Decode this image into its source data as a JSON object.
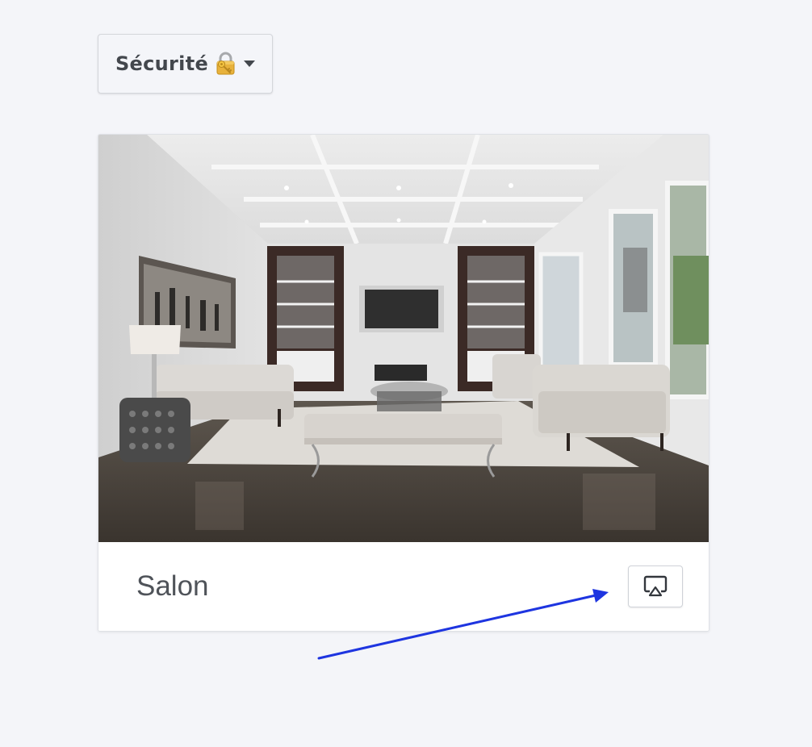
{
  "dropdown": {
    "label": "Sécurité",
    "icon": "locked-with-key-icon",
    "caret_icon": "caret-down-icon"
  },
  "card": {
    "image": "living-room-photo",
    "title": "Salon",
    "action_icon": "airplay-icon"
  },
  "annotation": {
    "type": "arrow",
    "color": "#1e35e0",
    "points_to": "airplay-button"
  },
  "colors": {
    "background": "#f4f5f9",
    "card": "#ffffff",
    "text": "#4f5359",
    "arrow": "#1e35e0"
  }
}
